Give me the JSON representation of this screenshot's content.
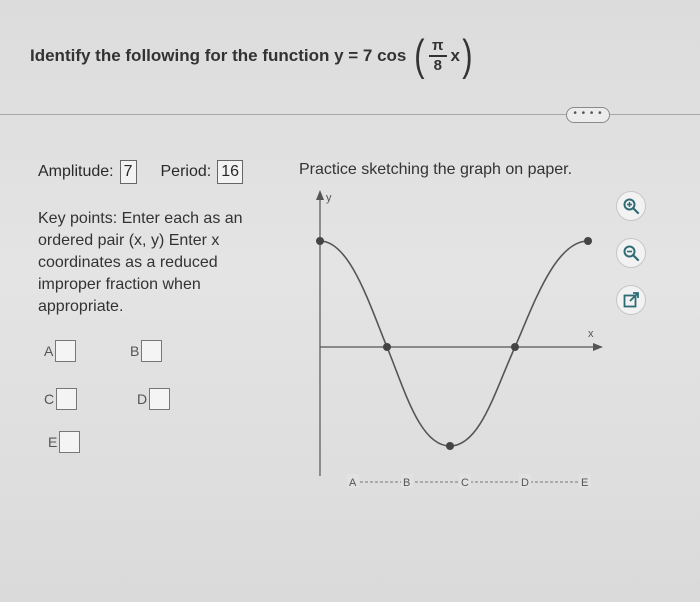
{
  "question": {
    "prefix": "Identify the following for the function y = 7 cos",
    "numerator": "π",
    "denominator": "8",
    "variable": "x"
  },
  "more_button": "• • • •",
  "amplitude": {
    "label": "Amplitude:",
    "value": "7"
  },
  "period": {
    "label": "Period:",
    "value": "16"
  },
  "instructions": "Key points: Enter each as an ordered pair (x, y)  Enter x coordinates as a reduced improper fraction when appropriate.",
  "key_points": [
    {
      "label": "A",
      "value": ""
    },
    {
      "label": "B",
      "value": ""
    },
    {
      "label": "C",
      "value": ""
    },
    {
      "label": "D",
      "value": ""
    },
    {
      "label": "E",
      "value": ""
    }
  ],
  "graph": {
    "title": "Practice sketching the graph on paper.",
    "y_axis_label": "y",
    "x_axis_label": "x",
    "bottom_labels": [
      "A",
      "B",
      "C",
      "D",
      "E"
    ]
  },
  "tools": [
    {
      "name": "zoom-in-icon"
    },
    {
      "name": "zoom-out-icon"
    },
    {
      "name": "popout-icon"
    }
  ],
  "colors": {
    "curve": "#555555",
    "point": "#444444",
    "axis": "#555555",
    "tool_icon": "#2f6b74"
  }
}
